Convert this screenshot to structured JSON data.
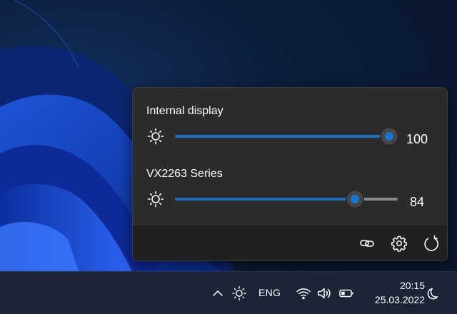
{
  "flyout": {
    "monitors": [
      {
        "name": "Internal display",
        "brightness": 100
      },
      {
        "name": "VX2263 Series",
        "brightness": 84
      }
    ],
    "footer_icons": [
      "link-icon",
      "gear-icon",
      "refresh-icon"
    ]
  },
  "taskbar": {
    "tray_icons": [
      "chevron-up-icon",
      "brightness-icon",
      "wifi-icon",
      "speaker-icon",
      "battery-icon",
      "moon-icon"
    ],
    "language": "ENG",
    "time": "20:15",
    "date": "25.03.2022"
  },
  "colors": {
    "accent": "#1a6fc0",
    "flyout_bg": "#2b2b2b",
    "taskbar_bg": "#1c2436"
  }
}
